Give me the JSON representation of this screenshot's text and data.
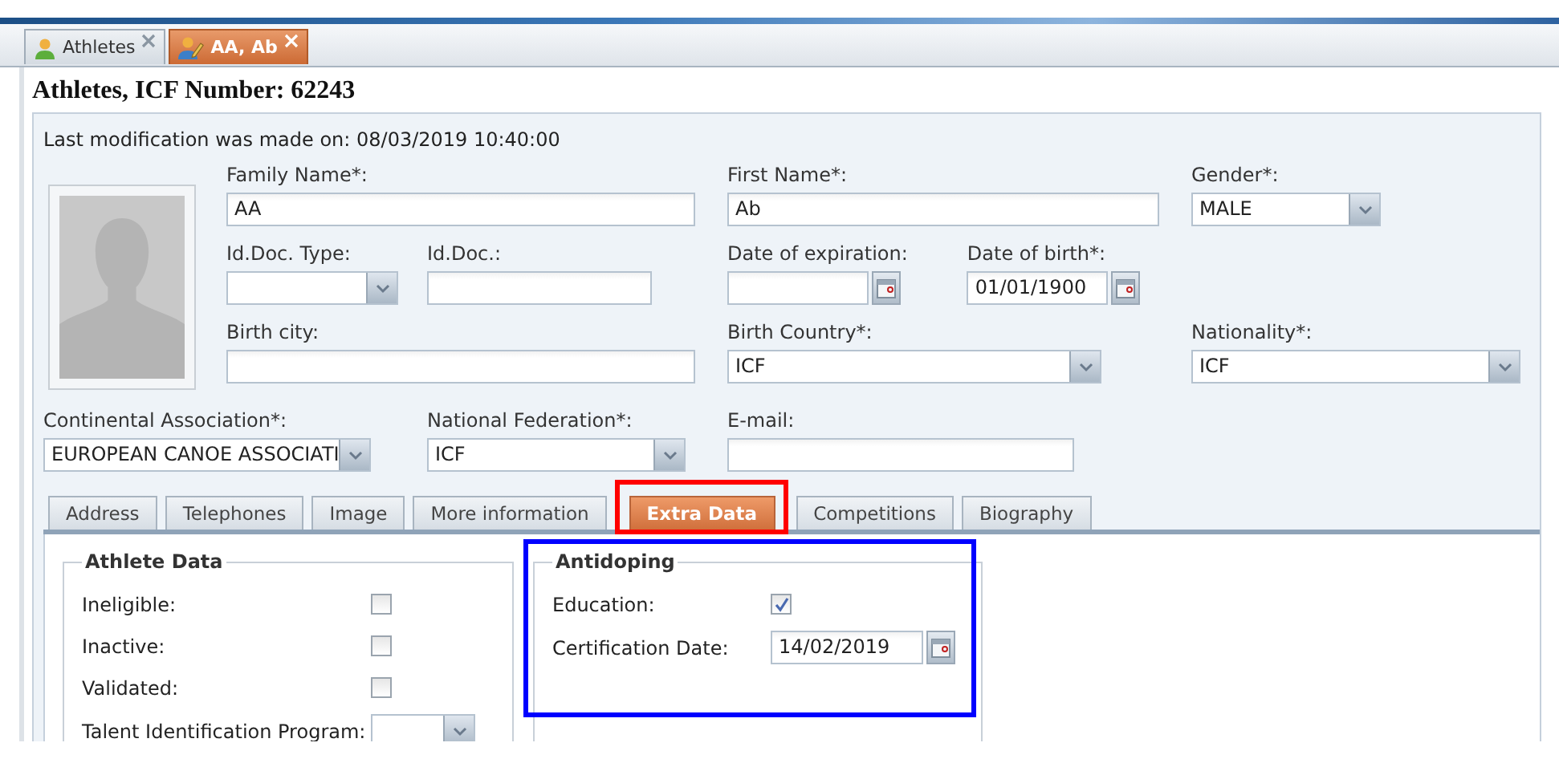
{
  "top_tabs": [
    {
      "label": "Athletes",
      "selected": false,
      "kind": "user"
    },
    {
      "label": "AA, Ab",
      "selected": true,
      "kind": "user-edit"
    }
  ],
  "title": "Athletes, ICF Number: 62243",
  "last_modification": "Last modification was made on: 08/03/2019 10:40:00",
  "field_rows": [
    {
      "fields": [
        {
          "label": "Family Name*:",
          "kind": "text",
          "value": "AA"
        },
        {
          "label": "First Name*:",
          "kind": "text",
          "value": "Ab"
        },
        {
          "label": "Gender*:",
          "kind": "combo",
          "value": "MALE"
        }
      ]
    },
    {
      "fields": [
        {
          "label": "Id.Doc. Type:",
          "kind": "combo"
        },
        {
          "label": "Id.Doc.:",
          "kind": "text"
        },
        {
          "label": "Date of expiration:",
          "kind": "date"
        },
        {
          "label": "Date of birth*:",
          "kind": "date",
          "value": "01/01/1900"
        }
      ]
    },
    {
      "fields": [
        {
          "label": "Birth city:",
          "kind": "text"
        },
        {
          "label": "Birth Country*:",
          "kind": "combo",
          "value": "ICF"
        },
        {
          "label": "Nationality*:",
          "kind": "combo",
          "value": "ICF"
        }
      ]
    },
    {
      "fields": [
        {
          "label": "Continental Association*:",
          "kind": "combo",
          "value": "EUROPEAN CANOE ASSOCIATI"
        },
        {
          "label": "National Federation*:",
          "kind": "combo",
          "value": "ICF"
        },
        {
          "label": "E-mail:",
          "kind": "text"
        }
      ]
    }
  ],
  "detail_tabs": [
    {
      "label": "Address",
      "selected": false
    },
    {
      "label": "Telephones",
      "selected": false
    },
    {
      "label": "Image",
      "selected": false
    },
    {
      "label": "More information",
      "selected": false
    },
    {
      "label": "Extra Data",
      "selected": true
    },
    {
      "label": "Competitions",
      "selected": false
    },
    {
      "label": "Biography",
      "selected": false
    }
  ],
  "groups": [
    {
      "title": "Athlete Data",
      "rows": [
        {
          "label": "Ineligible:",
          "kind": "checkbox",
          "checked": false
        },
        {
          "label": "Inactive:",
          "kind": "checkbox",
          "checked": false
        },
        {
          "label": "Validated:",
          "kind": "checkbox",
          "checked": false
        },
        {
          "label": "Talent Identification Program:",
          "kind": "combo"
        }
      ]
    },
    {
      "title": "Antidoping",
      "rows": [
        {
          "label": "Education:",
          "kind": "checkbox",
          "checked": true
        },
        {
          "label": "Certification Date:",
          "kind": "date",
          "value": "14/02/2019"
        }
      ]
    }
  ],
  "highlight_frames": [
    {
      "color": "#ff0000"
    },
    {
      "color": "#0000ff"
    }
  ]
}
